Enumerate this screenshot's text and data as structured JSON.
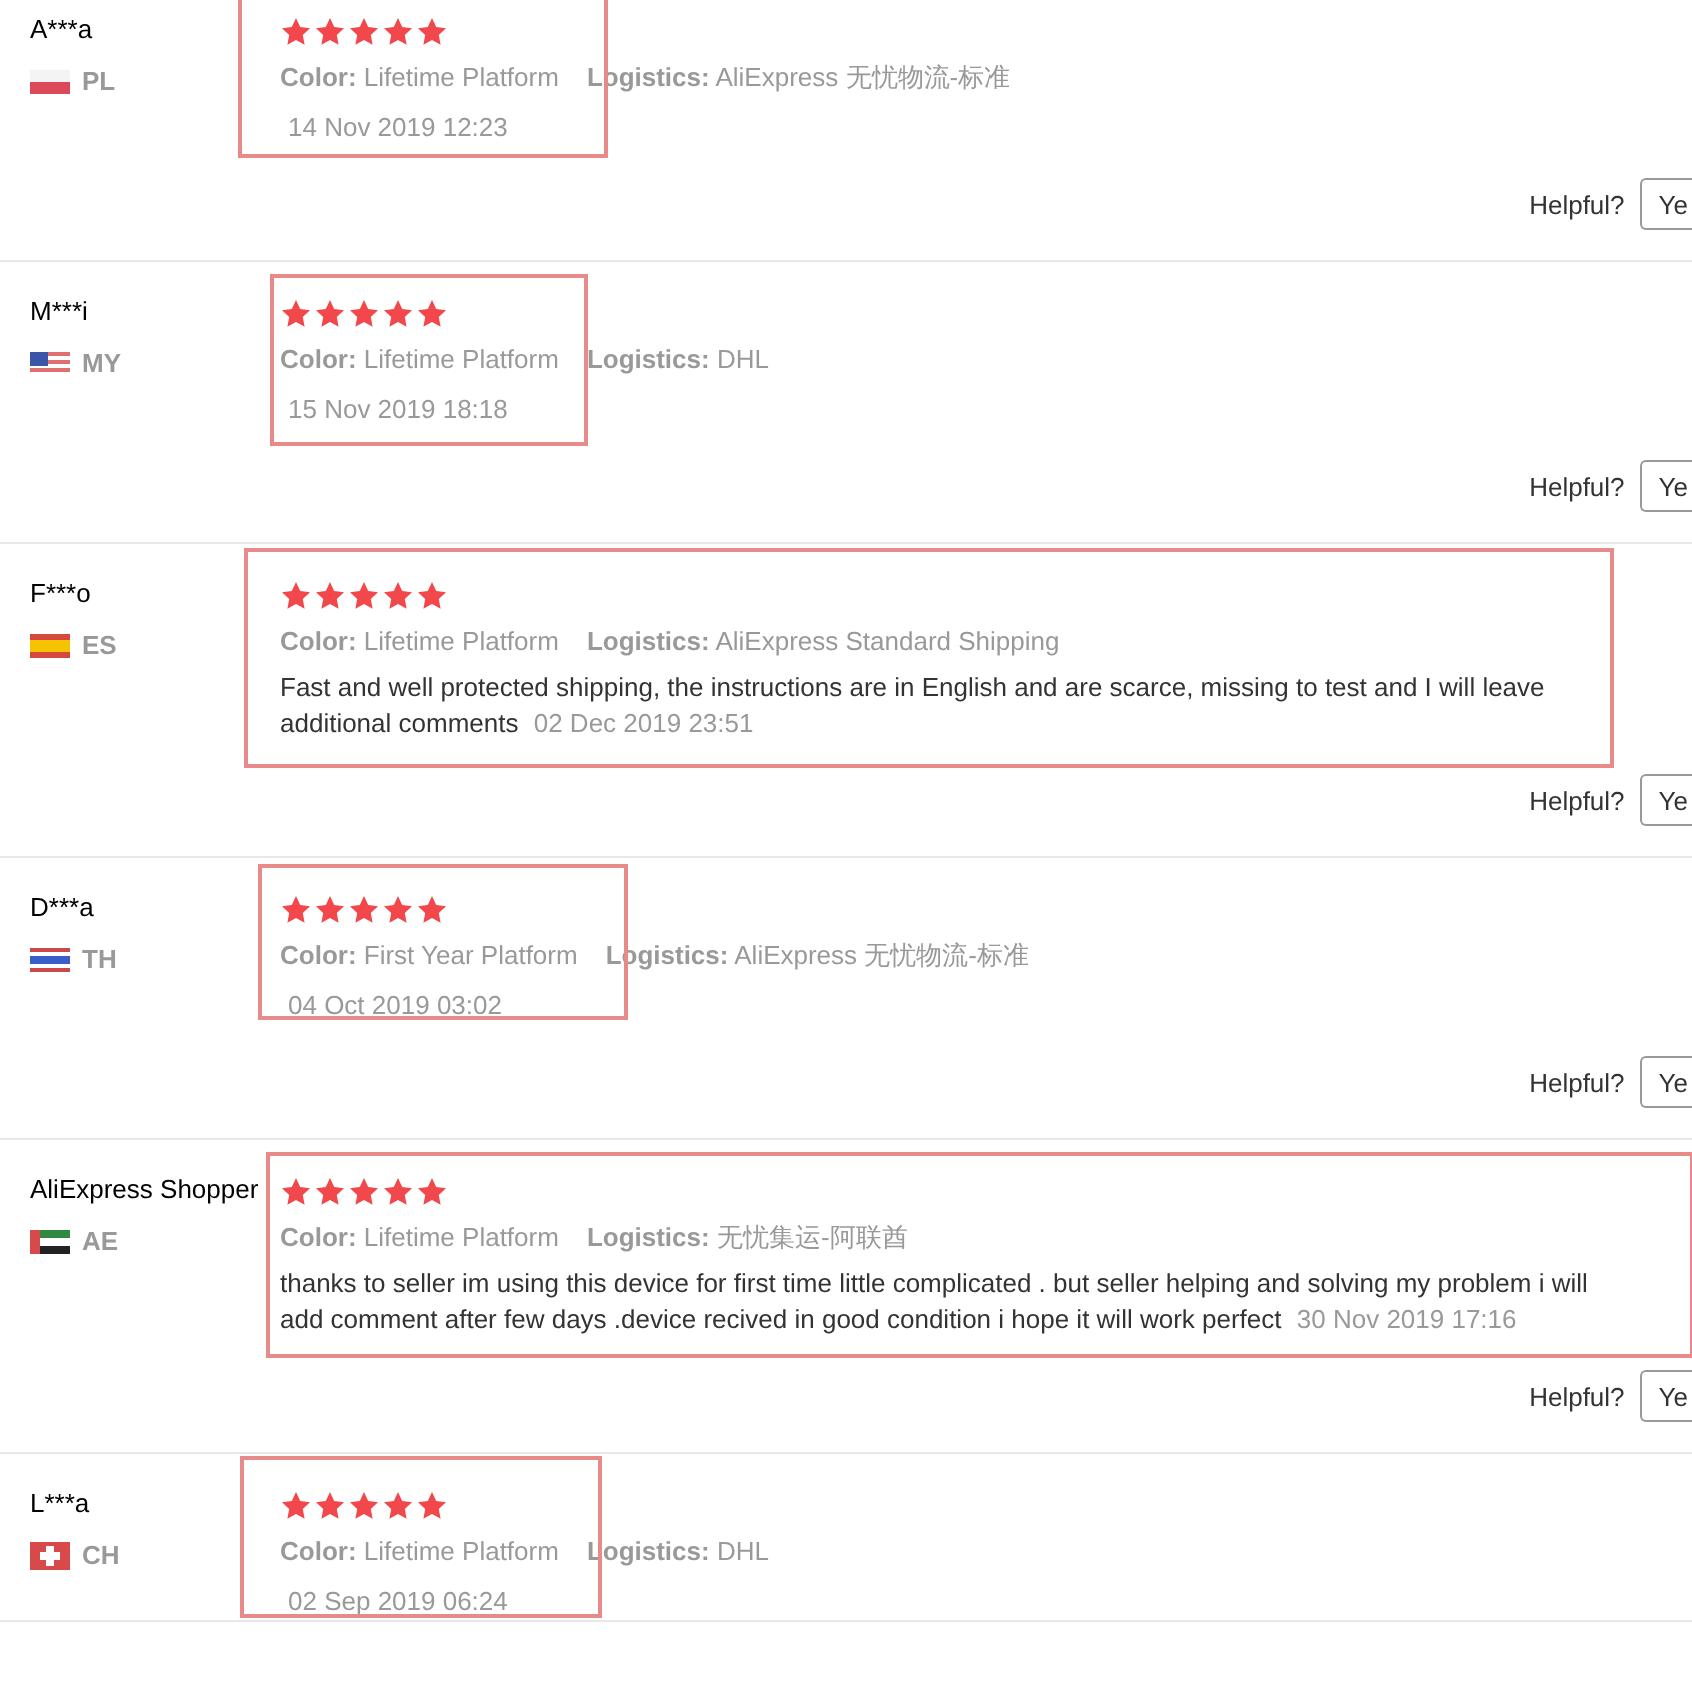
{
  "reviews": [
    {
      "name": "A***a",
      "country": {
        "code": "PL",
        "kind": "pl"
      },
      "stars": 5,
      "attributes": [
        "**Color:** Lifetime Platform",
        "**Logistics:** AliExpress 无忧物流-标准"
      ],
      "date": "14 Nov 2019 12:23",
      "helpful": {
        "label": "Helpful?",
        "button": "Ye"
      }
    },
    {
      "name": "M***i",
      "country": {
        "code": "MY",
        "kind": "my"
      },
      "stars": 5,
      "attributes": [
        "**Color:** Lifetime Platform",
        "**Logistics:** DHL"
      ],
      "date": "15 Nov 2019 18:18",
      "helpful": {
        "label": "Helpful?",
        "button": "Ye"
      }
    },
    {
      "name": "F***o",
      "country": {
        "code": "ES",
        "kind": "es"
      },
      "stars": 5,
      "attributes": [
        "**Color:** Lifetime Platform",
        "**Logistics:** AliExpress Standard Shipping"
      ],
      "comment": "Fast and well protected shipping, the instructions are in English and are scarce, missing to test and I will leave additional comments",
      "date": "02 Dec 2019 23:51",
      "helpful": {
        "label": "Helpful?",
        "button": "Ye"
      }
    },
    {
      "name": "D***a",
      "country": {
        "code": "TH",
        "kind": "th"
      },
      "stars": 5,
      "attributes": [
        "**Color:** First Year Platform",
        "**Logistics:** AliExpress 无忧物流-标准"
      ],
      "date": "04 Oct 2019 03:02",
      "helpful": {
        "label": "Helpful?",
        "button": "Ye"
      }
    },
    {
      "name": "AliExpress Shopper",
      "country": {
        "code": "AE",
        "kind": "ae"
      },
      "stars": 5,
      "attributes": [
        "**Color:** Lifetime Platform",
        "**Logistics:** 无忧集运-阿联酋"
      ],
      "comment": "thanks to seller im using this device for first time little complicated . but seller helping and solving my problem i will add comment after few days .device recived in good condition i hope it will work perfect",
      "date": "30 Nov 2019 17:16",
      "helpful": {
        "label": "Helpful?",
        "button": "Ye"
      }
    },
    {
      "name": "L***a",
      "country": {
        "code": "CH",
        "kind": "ch"
      },
      "stars": 5,
      "attributes": [
        "**Color:** Lifetime Platform",
        "**Logistics:** DHL"
      ],
      "date": "02 Sep 2019 06:24"
    }
  ]
}
